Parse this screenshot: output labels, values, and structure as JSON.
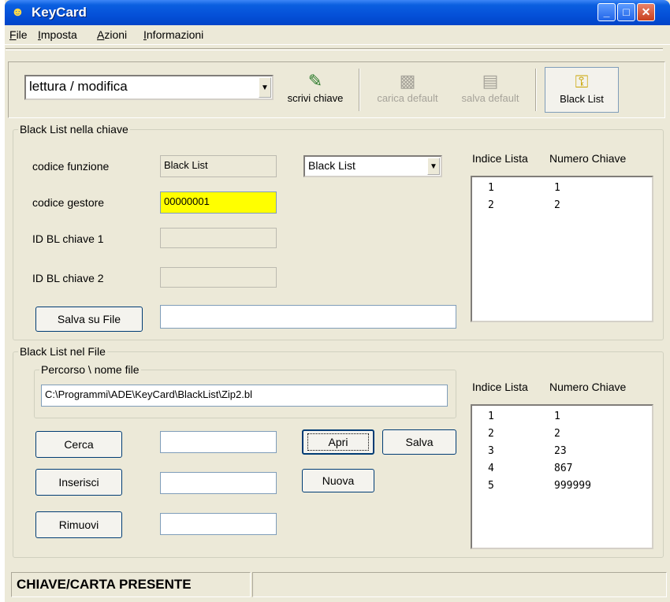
{
  "window": {
    "title": "KeyCard"
  },
  "menu": [
    "File",
    "Imposta",
    "Azioni",
    "Informazioni"
  ],
  "toolbar": {
    "mode": "lettura / modifica",
    "scrivi": "scrivi chiave",
    "carica": "carica default",
    "salva": "salva default",
    "blacklist": "Black List"
  },
  "key_section": {
    "legend": "Black List nella chiave",
    "codice_funzione_label": "codice funzione",
    "codice_funzione_value": "Black List",
    "codice_funzione_select": "Black List",
    "codice_gestore_label": "codice gestore",
    "codice_gestore_value": "00000001",
    "id_bl_1_label": "ID BL chiave 1",
    "id_bl_2_label": "ID BL chiave 2",
    "salva_su_file": "Salva su File",
    "list_header_index": "Indice Lista",
    "list_header_number": "Numero Chiave",
    "rows": [
      {
        "index": "1",
        "number": "1"
      },
      {
        "index": "2",
        "number": "2"
      }
    ]
  },
  "file_section": {
    "legend": "Black List nel File",
    "path_legend": "Percorso \\ nome file",
    "path_value": "C:\\Programmi\\ADE\\KeyCard\\BlackList\\Zip2.bl",
    "cerca": "Cerca",
    "inserisci": "Inserisci",
    "rimuovi": "Rimuovi",
    "apri": "Apri",
    "nuova": "Nuova",
    "salva": "Salva",
    "list_header_index": "Indice Lista",
    "list_header_number": "Numero Chiave",
    "rows": [
      {
        "index": "1",
        "number": "1"
      },
      {
        "index": "2",
        "number": "2"
      },
      {
        "index": "3",
        "number": "23"
      },
      {
        "index": "4",
        "number": "867"
      },
      {
        "index": "5",
        "number": "999999"
      }
    ]
  },
  "status": {
    "text": "CHIAVE/CARTA PRESENTE"
  }
}
